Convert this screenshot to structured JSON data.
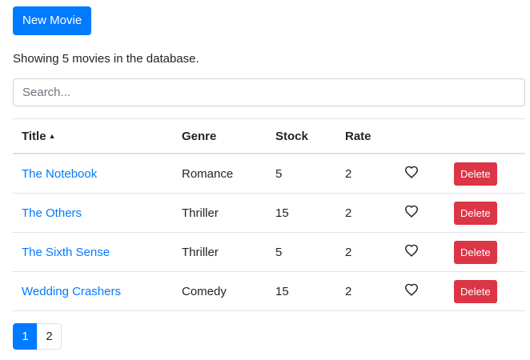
{
  "toolbar": {
    "new_movie_label": "New Movie"
  },
  "summary_text": "Showing 5 movies in the database.",
  "search": {
    "placeholder": "Search...",
    "value": ""
  },
  "table": {
    "columns": {
      "title": "Title",
      "genre": "Genre",
      "stock": "Stock",
      "rate": "Rate"
    },
    "sort_icon": "caret-up-icon",
    "delete_label": "Delete",
    "rows": [
      {
        "title": "The Notebook",
        "genre": "Romance",
        "stock": "5",
        "rate": "2",
        "liked": false
      },
      {
        "title": "The Others",
        "genre": "Thriller",
        "stock": "15",
        "rate": "2",
        "liked": false
      },
      {
        "title": "The Sixth Sense",
        "genre": "Thriller",
        "stock": "5",
        "rate": "2",
        "liked": false
      },
      {
        "title": "Wedding Crashers",
        "genre": "Comedy",
        "stock": "15",
        "rate": "2",
        "liked": false
      }
    ]
  },
  "pagination": {
    "pages": [
      "1",
      "2"
    ],
    "current": "1"
  },
  "colors": {
    "primary": "#007bff",
    "danger": "#dc3545",
    "border": "#dee2e6"
  }
}
